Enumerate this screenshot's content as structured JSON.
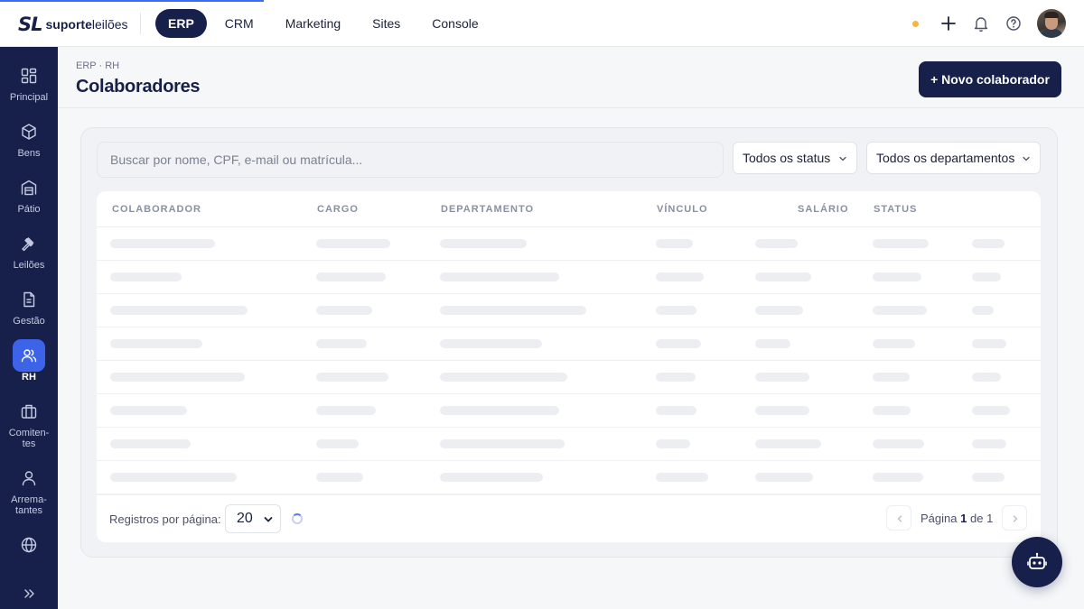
{
  "brand": {
    "mark": "SL",
    "name_bold": "suporte",
    "name_light": "leilões"
  },
  "topnav": [
    {
      "label": "ERP",
      "active": true
    },
    {
      "label": "CRM",
      "active": false
    },
    {
      "label": "Marketing",
      "active": false
    },
    {
      "label": "Sites",
      "active": false
    },
    {
      "label": "Console",
      "active": false
    }
  ],
  "topbar_icons": [
    "plus-icon",
    "bell-icon",
    "help-icon"
  ],
  "sidebar": [
    {
      "label": "Principal",
      "icon": "grid-icon"
    },
    {
      "label": "Bens",
      "icon": "box-icon"
    },
    {
      "label": "Pátio",
      "icon": "warehouse-icon"
    },
    {
      "label": "Leilões",
      "icon": "gavel-icon"
    },
    {
      "label": "Gestão",
      "icon": "document-icon"
    },
    {
      "label": "RH",
      "icon": "users-icon",
      "active": true
    },
    {
      "label": "Comiten-\ntes",
      "icon": "briefcase-icon"
    },
    {
      "label": "Arrema-\ntantes",
      "icon": "user-icon"
    },
    {
      "label": "",
      "icon": "globe-icon"
    }
  ],
  "header": {
    "breadcrumb": "ERP · RH",
    "title": "Colaboradores",
    "new_button": "+ Novo colaborador"
  },
  "filters": {
    "search_placeholder": "Buscar por nome, CPF, e-mail ou matrícula...",
    "status": "Todos os status",
    "department": "Todos os departamentos"
  },
  "table": {
    "columns": [
      "COLABORADOR",
      "CARGO",
      "DEPARTAMENTO",
      "VÍNCULO",
      "SALÁRIO",
      "STATUS"
    ],
    "loading": true
  },
  "footer": {
    "rows_label": "Registros por página:",
    "rows_value": "20",
    "page_prefix": "Página",
    "page_current": "1",
    "page_mid": "de",
    "page_total": "1"
  },
  "colors": {
    "primary": "#17204a",
    "accent": "#3c63e8",
    "status_dot": "#f5b73b"
  }
}
